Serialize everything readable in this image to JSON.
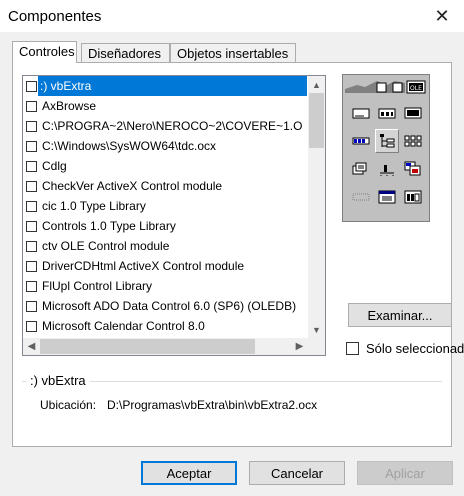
{
  "window": {
    "title": "Componentes",
    "close_glyph": "✕"
  },
  "tabs": [
    {
      "label": "Controles",
      "active": true
    },
    {
      "label": "Diseñadores",
      "active": false
    },
    {
      "label": "Objetos insertables",
      "active": false
    }
  ],
  "components": {
    "items": [
      {
        "label": ":) vbExtra",
        "checked": false,
        "selected": true
      },
      {
        "label": "AxBrowse",
        "checked": false,
        "selected": false
      },
      {
        "label": "C:\\PROGRA~2\\Nero\\NEROCO~2\\COVERE~1.O",
        "checked": false,
        "selected": false
      },
      {
        "label": "C:\\Windows\\SysWOW64\\tdc.ocx",
        "checked": false,
        "selected": false
      },
      {
        "label": "Cdlg",
        "checked": false,
        "selected": false
      },
      {
        "label": "CheckVer ActiveX Control module",
        "checked": false,
        "selected": false
      },
      {
        "label": "cic 1.0 Type Library",
        "checked": false,
        "selected": false
      },
      {
        "label": "Controls 1.0 Type Library",
        "checked": false,
        "selected": false
      },
      {
        "label": "ctv OLE Control module",
        "checked": false,
        "selected": false
      },
      {
        "label": "DriverCDHtml ActiveX Control module",
        "checked": false,
        "selected": false
      },
      {
        "label": "FlUpl Control Library",
        "checked": false,
        "selected": false
      },
      {
        "label": "Microsoft ADO Data Control 6.0 (SP6) (OLEDB)",
        "checked": false,
        "selected": false
      },
      {
        "label": "Microsoft Calendar Control 8.0",
        "checked": false,
        "selected": false
      }
    ],
    "scroll": {
      "up": "▲",
      "down": "▼",
      "left": "◀",
      "right": "▶"
    }
  },
  "buttons": {
    "browse": "Examinar...",
    "accept": "Aceptar",
    "cancel": "Cancelar",
    "apply": "Aplicar"
  },
  "selected_only": {
    "label": "Sólo seleccionados",
    "checked": false
  },
  "details": {
    "group_title": ":) vbExtra",
    "location_label": "Ubicación:",
    "location_value": "D:\\Programas\\vbExtra\\bin\\vbExtra2.ocx"
  },
  "colors": {
    "selection": "#0078d7",
    "default_button_border": "#0078d7",
    "preview_bg": "#c0c0c0"
  },
  "preview_icons": [
    "label-icon",
    "textbox-icon",
    "ole-icon",
    "progressbar-icon",
    "treeview-icon",
    "listview-icon",
    "imagelist-icon",
    "slider-icon",
    "toolbar-icon",
    "statusbar-icon",
    "picturebox-icon",
    "frame-icon"
  ]
}
